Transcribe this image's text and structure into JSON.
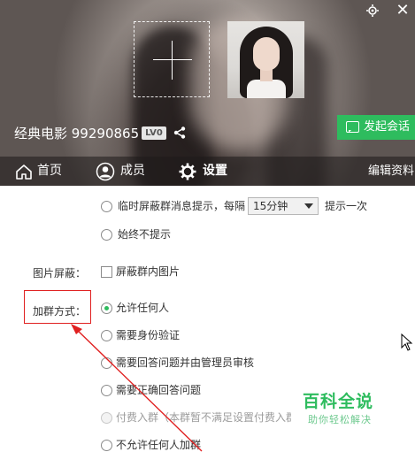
{
  "header": {
    "group_name": "经典电影 99290865",
    "level_badge": "LV0",
    "start_chat_label": "发起会话",
    "upload_placeholder_icon": "plus-icon",
    "top_icons": [
      "settings-gear-icon",
      "close-icon"
    ]
  },
  "tabs": [
    {
      "label": "首页",
      "icon": "home-icon"
    },
    {
      "label": "成员",
      "icon": "member-icon"
    },
    {
      "label": "设置",
      "icon": "gear-icon",
      "active": true
    },
    {
      "label": "编辑资料"
    }
  ],
  "settings": {
    "temp_block_prefix": "临时屏蔽群消息提示，每隔",
    "temp_block_interval": "15分钟",
    "temp_block_suffix": "提示一次",
    "never_notify": "始终不提示",
    "image_block_label": "图片屏蔽：",
    "image_block_option": "屏蔽群内图片",
    "join_method_label": "加群方式：",
    "join_options": [
      {
        "label": "允许任何人",
        "checked": true,
        "disabled": false
      },
      {
        "label": "需要身份验证",
        "checked": false,
        "disabled": false
      },
      {
        "label": "需要回答问题并由管理员审核",
        "checked": false,
        "disabled": false
      },
      {
        "label": "需要正确回答问题",
        "checked": false,
        "disabled": false
      },
      {
        "label": "付费入群（本群暂不满足设置付费入群",
        "checked": false,
        "disabled": true
      },
      {
        "label": "不允许任何人加群",
        "checked": false,
        "disabled": false
      }
    ]
  },
  "watermark": {
    "title": "百科全说",
    "subtitle": "助你轻松解决"
  },
  "colors": {
    "accent_green": "#2ebc5e",
    "highlight_red": "#e02020"
  }
}
